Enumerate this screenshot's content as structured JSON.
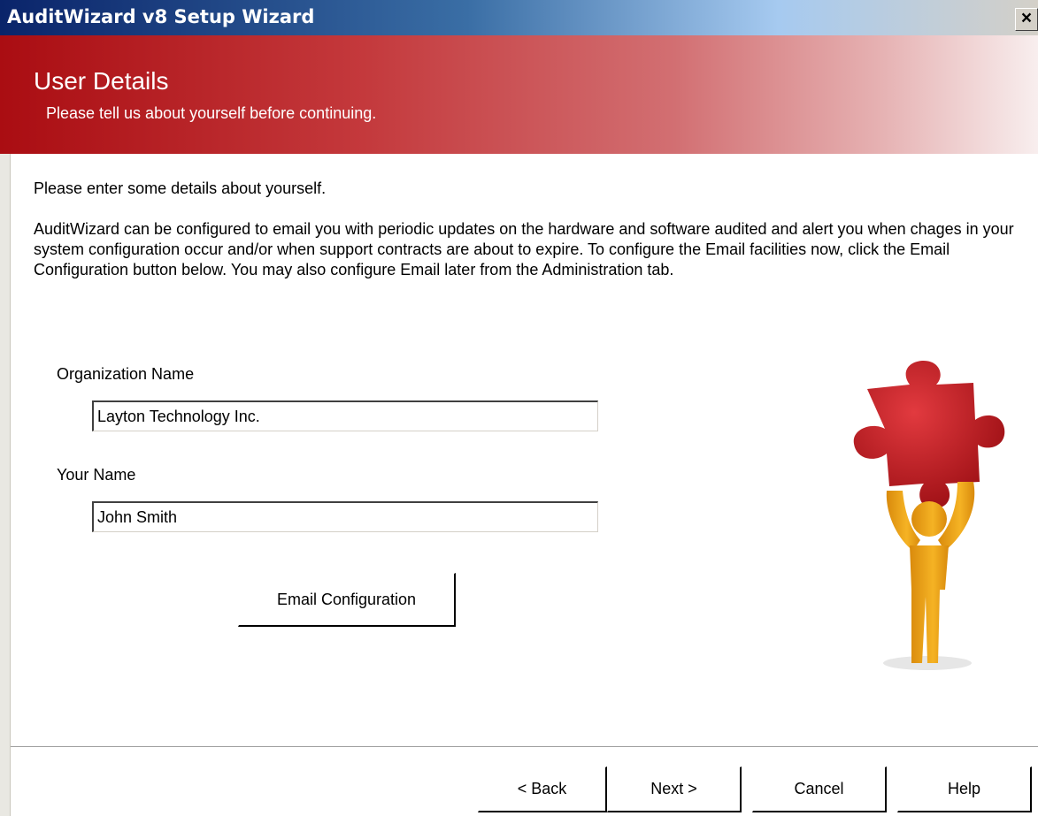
{
  "window": {
    "title": "AuditWizard v8 Setup Wizard",
    "close_glyph": "×"
  },
  "header": {
    "title": "User Details",
    "subtitle": "Please tell us about yourself before continuing."
  },
  "body": {
    "intro": "Please enter some details about yourself.",
    "description": "AuditWizard can be configured to email you with periodic updates on the hardware and software audited and alert you when chages in your system configuration occur and/or when support contracts are about to expire. To configure the Email facilities now, click the Email Configuration button below.  You may also configure Email later from the Administration tab."
  },
  "form": {
    "org_label": "Organization Name",
    "org_value": "Layton Technology Inc.",
    "name_label": "Your Name",
    "name_value": "John Smith",
    "email_button": "Email Configuration"
  },
  "footer": {
    "back": "< Back",
    "next": "Next >",
    "cancel": "Cancel",
    "help": "Help"
  },
  "illustration": {
    "icon": "puzzle-person-icon",
    "colors": {
      "puzzle": "#c0161b",
      "person": "#f0a91a"
    }
  }
}
